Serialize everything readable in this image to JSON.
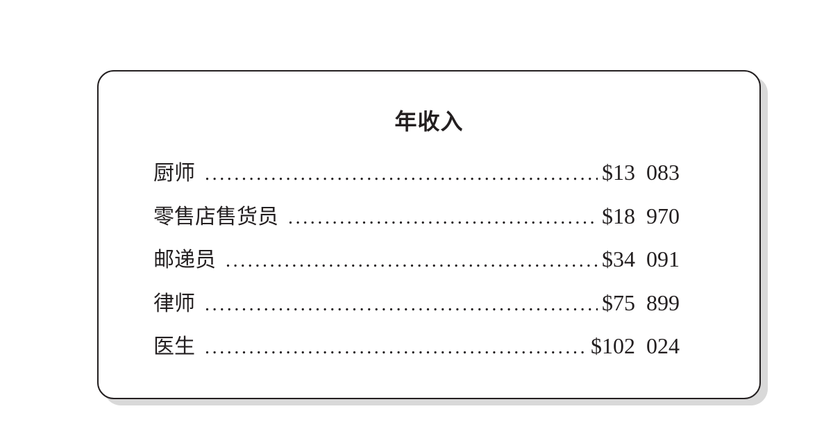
{
  "title": "年收入",
  "rows": [
    {
      "job": "厨师",
      "salary": "$13  083"
    },
    {
      "job": "零售店售货员",
      "salary": "$18  970"
    },
    {
      "job": "邮递员",
      "salary": "$34  091"
    },
    {
      "job": "律师",
      "salary": "$75  899"
    },
    {
      "job": "医生",
      "salary": "$102  024"
    }
  ]
}
